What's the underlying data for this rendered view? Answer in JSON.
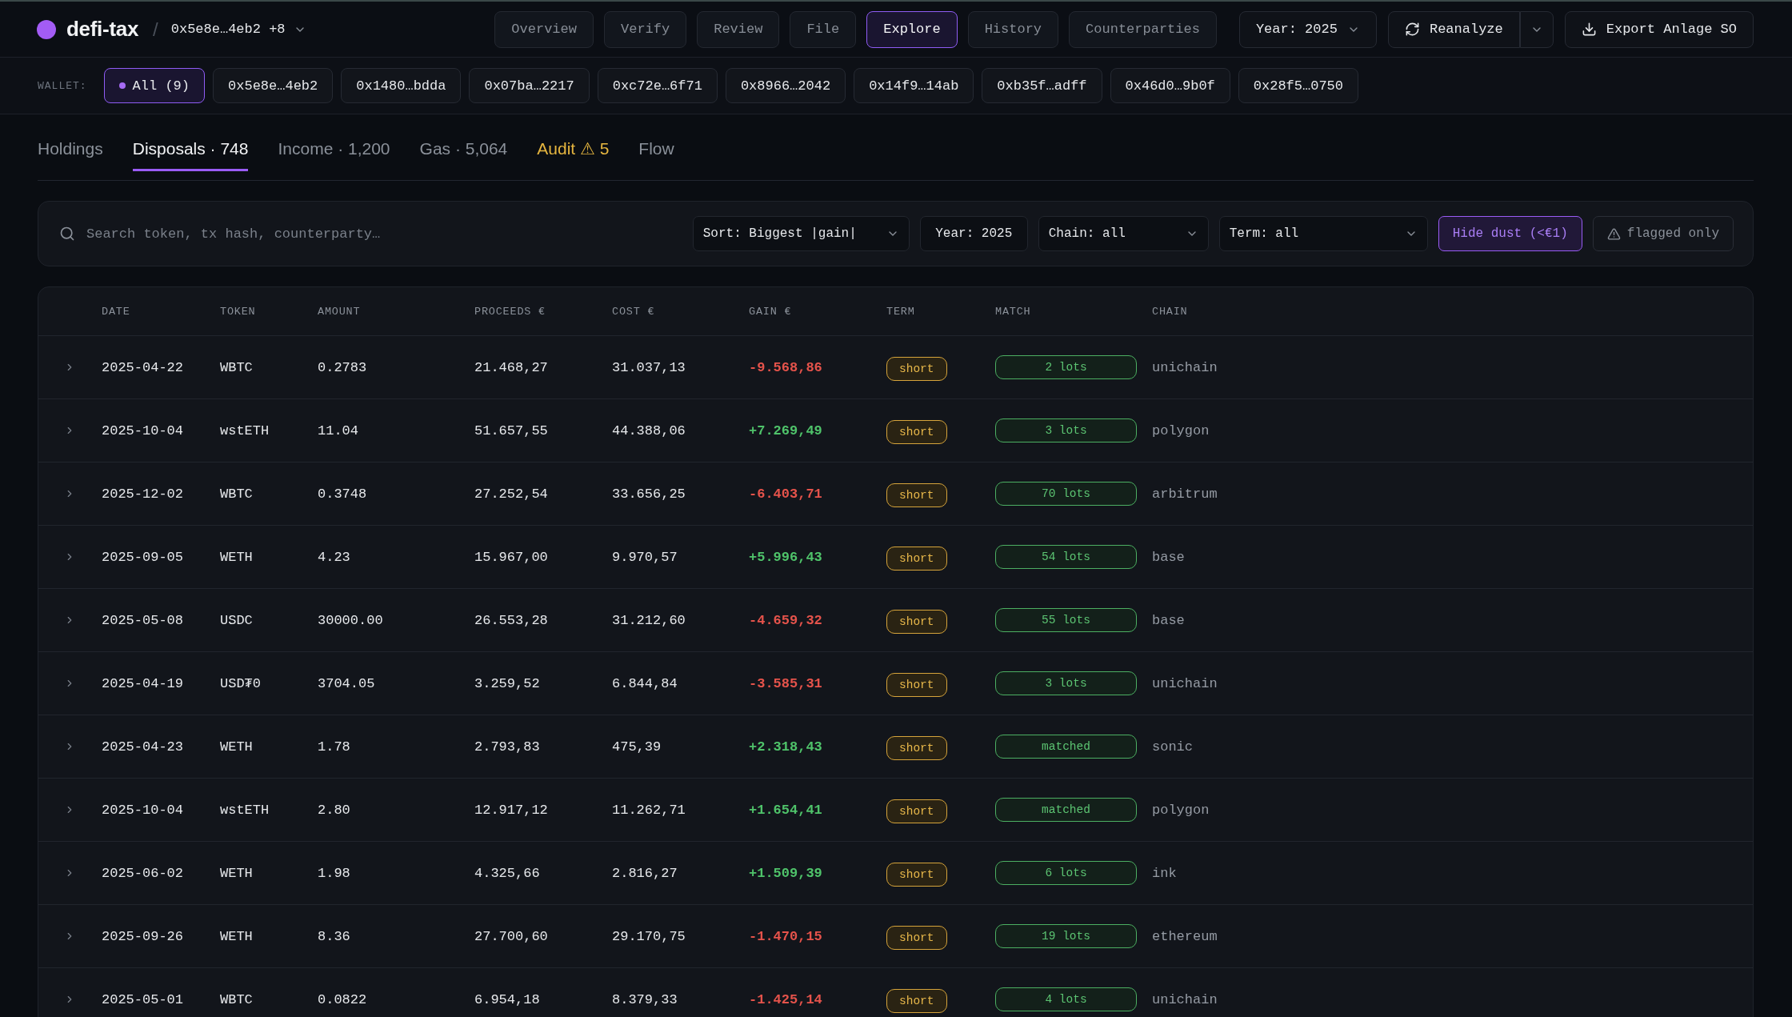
{
  "app": {
    "name": "defi-tax",
    "separator": "/",
    "wallet_selector": "0x5e8e…4eb2 +8"
  },
  "nav": [
    {
      "label": "Overview",
      "selected": false
    },
    {
      "label": "Verify",
      "selected": false
    },
    {
      "label": "Review",
      "selected": false
    },
    {
      "label": "File",
      "selected": false
    },
    {
      "label": "Explore",
      "selected": true
    },
    {
      "label": "History",
      "selected": false
    },
    {
      "label": "Counterparties",
      "selected": false
    }
  ],
  "toolbar": {
    "year": "Year: 2025",
    "reanalyze": "Reanalyze",
    "export": "Export Anlage SO"
  },
  "wallet_filter": {
    "label": "WALLET:",
    "chips": [
      {
        "label": "All (9)",
        "selected": true
      },
      {
        "label": "0x5e8e…4eb2",
        "selected": false
      },
      {
        "label": "0x1480…bdda",
        "selected": false
      },
      {
        "label": "0x07ba…2217",
        "selected": false
      },
      {
        "label": "0xc72e…6f71",
        "selected": false
      },
      {
        "label": "0x8966…2042",
        "selected": false
      },
      {
        "label": "0x14f9…14ab",
        "selected": false
      },
      {
        "label": "0xb35f…adff",
        "selected": false
      },
      {
        "label": "0x46d0…9b0f",
        "selected": false
      },
      {
        "label": "0x28f5…0750",
        "selected": false
      }
    ]
  },
  "tabs": [
    {
      "label": "Holdings",
      "selected": false,
      "kind": "plain"
    },
    {
      "label": "Disposals · 748",
      "selected": true,
      "kind": "plain"
    },
    {
      "label": "Income · 1,200",
      "selected": false,
      "kind": "plain"
    },
    {
      "label": "Gas · 5,064",
      "selected": false,
      "kind": "plain"
    },
    {
      "label": "Audit ⚠ 5",
      "selected": false,
      "kind": "warning"
    },
    {
      "label": "Flow",
      "selected": false,
      "kind": "plain"
    }
  ],
  "filters": {
    "search": {
      "placeholder": "Search token, tx hash, counterparty…"
    },
    "sort": "Sort: Biggest |gain|",
    "year": "Year: 2025",
    "chain": "Chain: all",
    "term": "Term: all",
    "hide_dust": {
      "label": "Hide dust (<€1)",
      "on": true
    },
    "flagged_only": {
      "label": "flagged only",
      "on": false
    }
  },
  "table": {
    "columns": [
      "DATE",
      "TOKEN",
      "AMOUNT",
      "PROCEEDS €",
      "COST €",
      "GAIN €",
      "TERM",
      "MATCH",
      "CHAIN"
    ],
    "rows": [
      {
        "expanded": false,
        "date": "2025-04-22",
        "token": "WBTC",
        "amount": "0.2783",
        "proceeds": "21.468,27",
        "cost": "31.037,13",
        "gain": {
          "value": "-9.568,86",
          "kind": "loss"
        },
        "term": "short",
        "match": "2 lots",
        "chain": "unichain"
      },
      {
        "expanded": false,
        "date": "2025-10-04",
        "token": "wstETH",
        "amount": "11.04",
        "proceeds": "51.657,55",
        "cost": "44.388,06",
        "gain": {
          "value": "+7.269,49",
          "kind": "gain"
        },
        "term": "short",
        "match": "3 lots",
        "chain": "polygon"
      },
      {
        "expanded": false,
        "date": "2025-12-02",
        "token": "WBTC",
        "amount": "0.3748",
        "proceeds": "27.252,54",
        "cost": "33.656,25",
        "gain": {
          "value": "-6.403,71",
          "kind": "loss"
        },
        "term": "short",
        "match": "70 lots",
        "chain": "arbitrum"
      },
      {
        "expanded": false,
        "date": "2025-09-05",
        "token": "WETH",
        "amount": "4.23",
        "proceeds": "15.967,00",
        "cost": "9.970,57",
        "gain": {
          "value": "+5.996,43",
          "kind": "gain"
        },
        "term": "short",
        "match": "54 lots",
        "chain": "base"
      },
      {
        "expanded": false,
        "date": "2025-05-08",
        "token": "USDC",
        "amount": "30000.00",
        "proceeds": "26.553,28",
        "cost": "31.212,60",
        "gain": {
          "value": "-4.659,32",
          "kind": "loss"
        },
        "term": "short",
        "match": "55 lots",
        "chain": "base"
      },
      {
        "expanded": false,
        "date": "2025-04-19",
        "token": "USD₮0",
        "amount": "3704.05",
        "proceeds": "3.259,52",
        "cost": "6.844,84",
        "gain": {
          "value": "-3.585,31",
          "kind": "loss"
        },
        "term": "short",
        "match": "3 lots",
        "chain": "unichain"
      },
      {
        "expanded": false,
        "date": "2025-04-23",
        "token": "WETH",
        "amount": "1.78",
        "proceeds": "2.793,83",
        "cost": "475,39",
        "gain": {
          "value": "+2.318,43",
          "kind": "gain"
        },
        "term": "short",
        "match": "matched",
        "chain": "sonic"
      },
      {
        "expanded": false,
        "date": "2025-10-04",
        "token": "wstETH",
        "amount": "2.80",
        "proceeds": "12.917,12",
        "cost": "11.262,71",
        "gain": {
          "value": "+1.654,41",
          "kind": "gain"
        },
        "term": "short",
        "match": "matched",
        "chain": "polygon"
      },
      {
        "expanded": false,
        "date": "2025-06-02",
        "token": "WETH",
        "amount": "1.98",
        "proceeds": "4.325,66",
        "cost": "2.816,27",
        "gain": {
          "value": "+1.509,39",
          "kind": "gain"
        },
        "term": "short",
        "match": "6 lots",
        "chain": "ink"
      },
      {
        "expanded": false,
        "date": "2025-09-26",
        "token": "WETH",
        "amount": "8.36",
        "proceeds": "27.700,60",
        "cost": "29.170,75",
        "gain": {
          "value": "-1.470,15",
          "kind": "loss"
        },
        "term": "short",
        "match": "19 lots",
        "chain": "ethereum"
      },
      {
        "expanded": false,
        "date": "2025-05-01",
        "token": "WBTC",
        "amount": "0.0822",
        "proceeds": "6.954,18",
        "cost": "8.379,33",
        "gain": {
          "value": "-1.425,14",
          "kind": "loss"
        },
        "term": "short",
        "match": "4 lots",
        "chain": "unichain"
      }
    ]
  }
}
